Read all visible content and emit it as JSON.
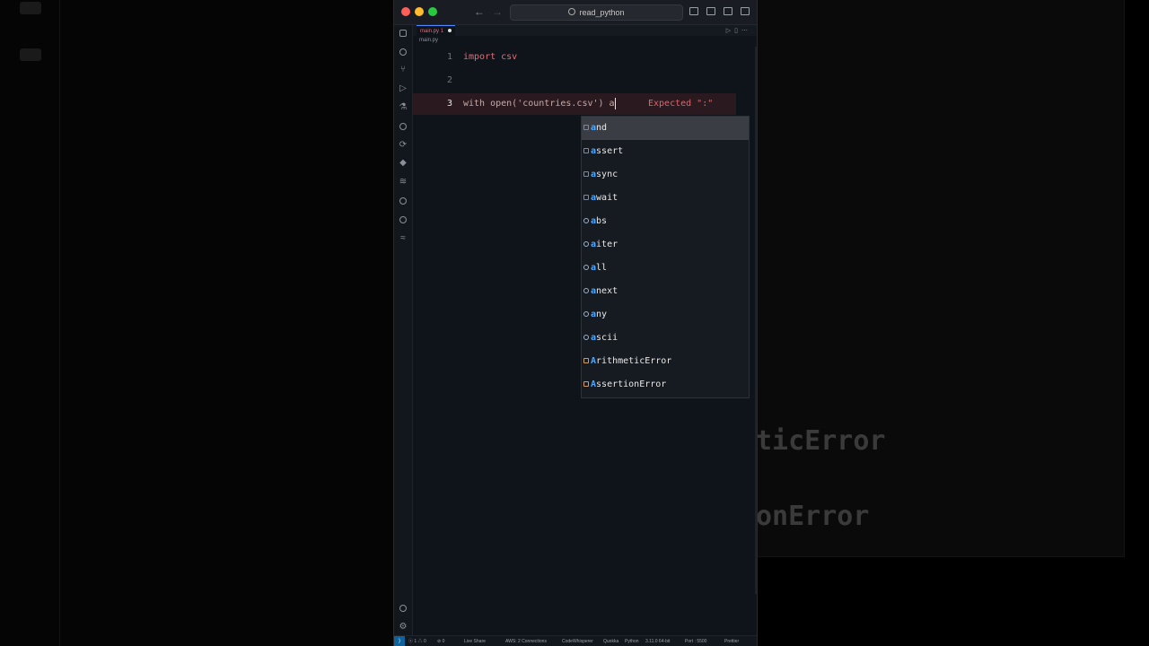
{
  "window": {
    "search_label": "read_python"
  },
  "tabs": [
    {
      "label": "main.py",
      "badge": "1"
    }
  ],
  "breadcrumb": "main.py",
  "editor": {
    "lines": [
      {
        "number": "1",
        "code": "import csv"
      },
      {
        "number": "2",
        "code": ""
      },
      {
        "number": "3",
        "code": "with open('countries.csv') a"
      }
    ],
    "diagnostic": "Expected \":\""
  },
  "suggestions": [
    {
      "prefix": "a",
      "rest": "nd",
      "kind": "keyword"
    },
    {
      "prefix": "a",
      "rest": "ssert",
      "kind": "keyword"
    },
    {
      "prefix": "a",
      "rest": "sync",
      "kind": "keyword"
    },
    {
      "prefix": "a",
      "rest": "wait",
      "kind": "keyword"
    },
    {
      "prefix": "a",
      "rest": "bs",
      "kind": "function"
    },
    {
      "prefix": "a",
      "rest": "iter",
      "kind": "function"
    },
    {
      "prefix": "a",
      "rest": "ll",
      "kind": "function"
    },
    {
      "prefix": "a",
      "rest": "next",
      "kind": "function"
    },
    {
      "prefix": "a",
      "rest": "ny",
      "kind": "function"
    },
    {
      "prefix": "a",
      "rest": "scii",
      "kind": "function"
    },
    {
      "prefix": "A",
      "rest": "rithmeticError",
      "kind": "class"
    },
    {
      "prefix": "A",
      "rest": "ssertionError",
      "kind": "class"
    }
  ],
  "statusbar": {
    "errors": "1",
    "warnings": "0",
    "ports": "0",
    "live_share": "Live Share",
    "aws": "AWS: 2 Connections",
    "codewhisperer": "CodeWhisperer",
    "quokka": "Quokka",
    "language": "Python",
    "interpreter": "3.11.0 64-bit",
    "port": "Port : 5500",
    "prettier": "Prettier"
  },
  "background": {
    "ghost_text_1": "ticError",
    "ghost_text_2": "onError"
  }
}
